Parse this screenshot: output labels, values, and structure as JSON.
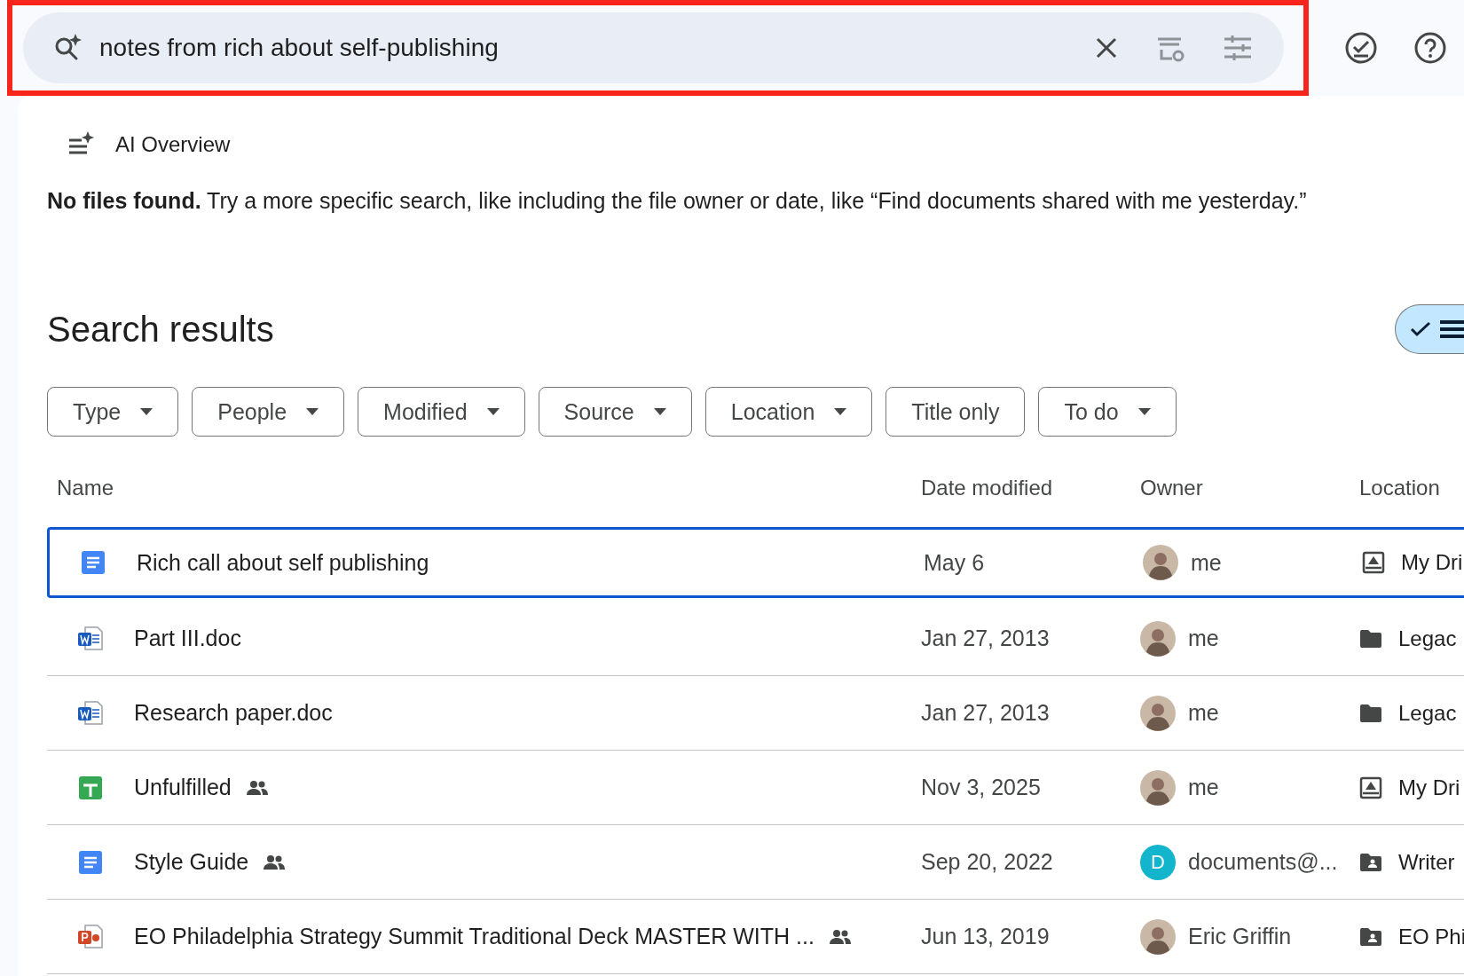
{
  "search": {
    "value": "notes from rich about self-publishing",
    "highlighted": true
  },
  "ai_overview": {
    "title": "AI Overview",
    "message": "**No files found.** Try a more specific search, like including the file owner or date, like “Find documents shared with me yesterday.”"
  },
  "results": {
    "heading": "Search results",
    "filters": [
      {
        "label": "Type",
        "dropdown": true
      },
      {
        "label": "People",
        "dropdown": true
      },
      {
        "label": "Modified",
        "dropdown": true
      },
      {
        "label": "Source",
        "dropdown": true
      },
      {
        "label": "Location",
        "dropdown": true
      },
      {
        "label": "Title only",
        "dropdown": false
      },
      {
        "label": "To do",
        "dropdown": true
      }
    ],
    "columns": [
      "Name",
      "Date modified",
      "Owner",
      "Location"
    ],
    "rows": [
      {
        "name": "Rich call about self publishing",
        "kind": "doc",
        "shared": false,
        "date": "May 6",
        "owner": {
          "name": "me",
          "kind": "photo"
        },
        "location": {
          "name": "My Dri",
          "kind": "drive"
        },
        "selected": true
      },
      {
        "name": "Part III.doc",
        "kind": "word",
        "shared": false,
        "date": "Jan 27, 2013",
        "owner": {
          "name": "me",
          "kind": "photo"
        },
        "location": {
          "name": "Legac",
          "kind": "folder"
        },
        "selected": false
      },
      {
        "name": "Research paper.doc",
        "kind": "word",
        "shared": false,
        "date": "Jan 27, 2013",
        "owner": {
          "name": "me",
          "kind": "photo"
        },
        "location": {
          "name": "Legac",
          "kind": "folder"
        },
        "selected": false
      },
      {
        "name": "Unfulfilled",
        "kind": "sheet",
        "shared": true,
        "date": "Nov 3, 2025",
        "owner": {
          "name": "me",
          "kind": "photo"
        },
        "location": {
          "name": "My Dri",
          "kind": "drive"
        },
        "selected": false
      },
      {
        "name": "Style Guide",
        "kind": "doc",
        "shared": true,
        "date": "Sep 20, 2022",
        "owner": {
          "name": "documents@...",
          "kind": "initial",
          "initial": "D",
          "color": "#12b5cb"
        },
        "location": {
          "name": "Writer",
          "kind": "shared-folder"
        },
        "selected": false
      },
      {
        "name": "EO Philadelphia Strategy Summit Traditional Deck MASTER WITH ...",
        "kind": "slides",
        "shared": true,
        "date": "Jun 13, 2019",
        "owner": {
          "name": "Eric Griffin",
          "kind": "photo"
        },
        "location": {
          "name": "EO Phi",
          "kind": "shared-folder"
        },
        "selected": false
      }
    ]
  }
}
